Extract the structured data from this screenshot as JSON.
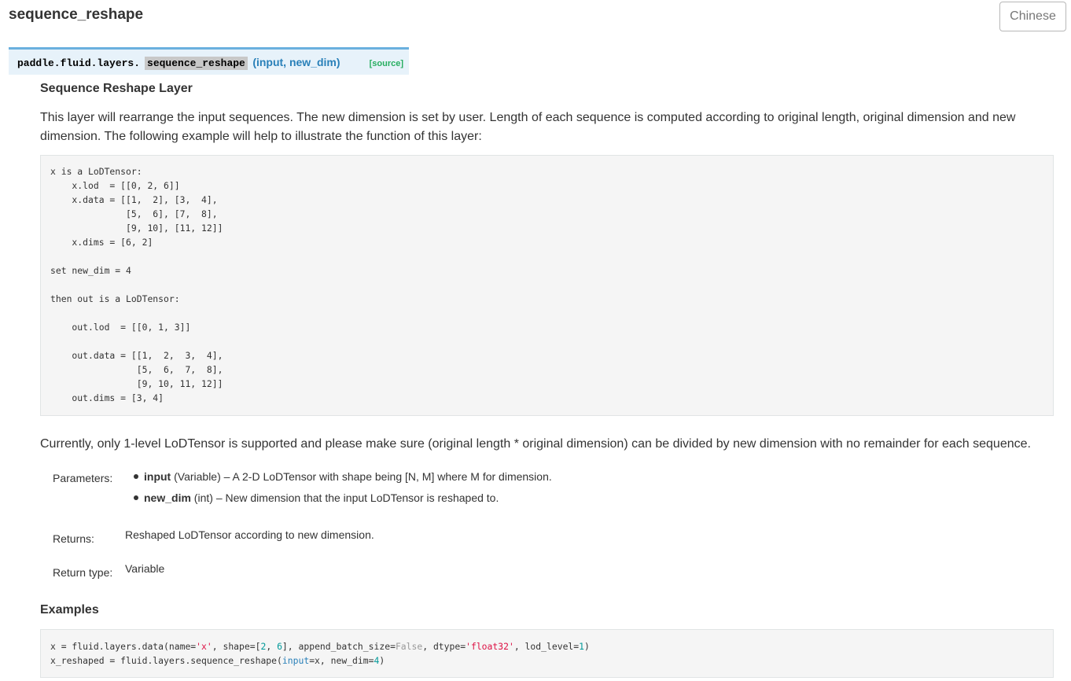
{
  "header": {
    "title": "sequence_reshape",
    "lang_button": "Chinese"
  },
  "signature": {
    "prefix": "paddle.fluid.layers.",
    "name": "sequence_reshape",
    "params": "(input, new_dim)",
    "source_link": "[source]"
  },
  "doc": {
    "heading": "Sequence Reshape Layer",
    "intro": "This layer will rearrange the input sequences. The new dimension is set by user. Length of each sequence is computed according to original length, original dimension and new dimension. The following example will help to illustrate the function of this layer:",
    "example_code": "x is a LoDTensor:\n    x.lod  = [[0, 2, 6]]\n    x.data = [[1,  2], [3,  4],\n              [5,  6], [7,  8],\n              [9, 10], [11, 12]]\n    x.dims = [6, 2]\n\nset new_dim = 4\n\nthen out is a LoDTensor:\n\n    out.lod  = [[0, 1, 3]]\n\n    out.data = [[1,  2,  3,  4],\n                [5,  6,  7,  8],\n                [9, 10, 11, 12]]\n    out.dims = [3, 4]",
    "note": "Currently, only 1-level LoDTensor is supported and please make sure (original length * original dimension) can be divided by new dimension with no remainder for each sequence."
  },
  "fields": {
    "parameters_label": "Parameters:",
    "parameters": [
      {
        "name": "input",
        "type": "(Variable)",
        "desc": "– A 2-D LoDTensor with shape being [N, M] where M for dimension."
      },
      {
        "name": "new_dim",
        "type": "(int)",
        "desc": "– New dimension that the input LoDTensor is reshaped to."
      }
    ],
    "returns_label": "Returns:",
    "returns": "Reshaped LoDTensor according to new dimension.",
    "return_type_label": "Return type:",
    "return_type": "Variable"
  },
  "examples": {
    "heading": "Examples",
    "line1": {
      "a": "x = fluid.layers.data(name=",
      "s1": "'x'",
      "b": ", shape=[",
      "n1": "2",
      "c": ", ",
      "n2": "6",
      "d": "], append_batch_size=",
      "k1": "False",
      "e": ", dtype=",
      "s2": "'float32'",
      "f": ", lod_level=",
      "n3": "1",
      "g": ")"
    },
    "line2": {
      "a": "x_reshaped = fluid.layers.sequence_reshape(",
      "k1": "input",
      "b": "=x, new_dim=",
      "n1": "4",
      "c": ")"
    }
  },
  "colors": {
    "signature_bg": "#e7f2fa",
    "signature_border": "#6ab0de",
    "params_color": "#2980b9",
    "source_color": "#27ae60",
    "code_bg": "#f5f5f5"
  }
}
